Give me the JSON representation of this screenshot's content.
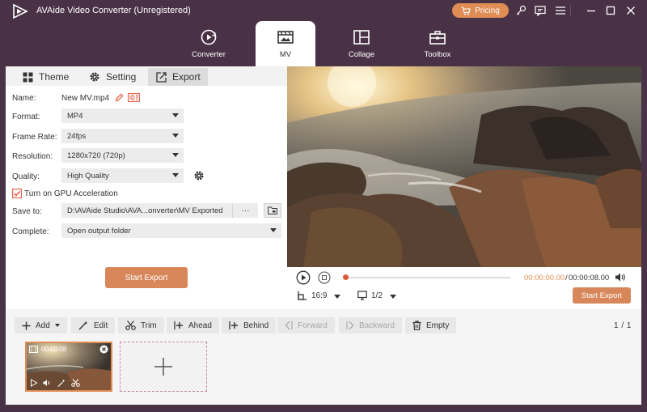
{
  "app": {
    "title": "AVAide Video Converter (Unregistered)",
    "pricing_label": "Pricing"
  },
  "nav": {
    "tabs": [
      {
        "label": "Converter",
        "icon": "converter-icon"
      },
      {
        "label": "MV",
        "icon": "mv-icon",
        "active": true
      },
      {
        "label": "Collage",
        "icon": "collage-icon"
      },
      {
        "label": "Toolbox",
        "icon": "toolbox-icon"
      }
    ]
  },
  "sub_tabs": [
    {
      "label": "Theme",
      "icon": "theme-grid-icon"
    },
    {
      "label": "Setting",
      "icon": "gear-icon"
    },
    {
      "label": "Export",
      "icon": "export-icon",
      "active": true
    }
  ],
  "export": {
    "name_label": "Name:",
    "name_value": "New MV.mp4",
    "format_label": "Format:",
    "format_value": "MP4",
    "frame_rate_label": "Frame Rate:",
    "frame_rate_value": "24fps",
    "resolution_label": "Resolution:",
    "resolution_value": "1280x720 (720p)",
    "quality_label": "Quality:",
    "quality_value": "High Quality",
    "gpu_label": "Turn on GPU Acceleration",
    "gpu_checked": true,
    "save_to_label": "Save to:",
    "save_to_value": "D:\\AVAide Studio\\AVA...onverter\\MV Exported",
    "more_label": "···",
    "complete_label": "Complete:",
    "complete_value": "Open output folder",
    "start_export_label": "Start Export"
  },
  "player": {
    "time_current": "00:00:00.00",
    "time_separator": "/",
    "time_total": "00:00:08.00",
    "progress": 0,
    "aspect_ratio": "16:9",
    "display_scale": "1/2",
    "start_export_label": "Start Export"
  },
  "toolbar": {
    "add_label": "Add",
    "edit_label": "Edit",
    "trim_label": "Trim",
    "ahead_label": "Ahead",
    "behind_label": "Behind",
    "forward_label": "Forward",
    "backward_label": "Backward",
    "empty_label": "Empty",
    "page_current": "1",
    "page_separator": "/",
    "page_total": "1"
  },
  "clip": {
    "duration": "00:00:08"
  },
  "colors": {
    "brand": "#4a3246",
    "accent": "#e08c55",
    "button": "#d8875a"
  }
}
